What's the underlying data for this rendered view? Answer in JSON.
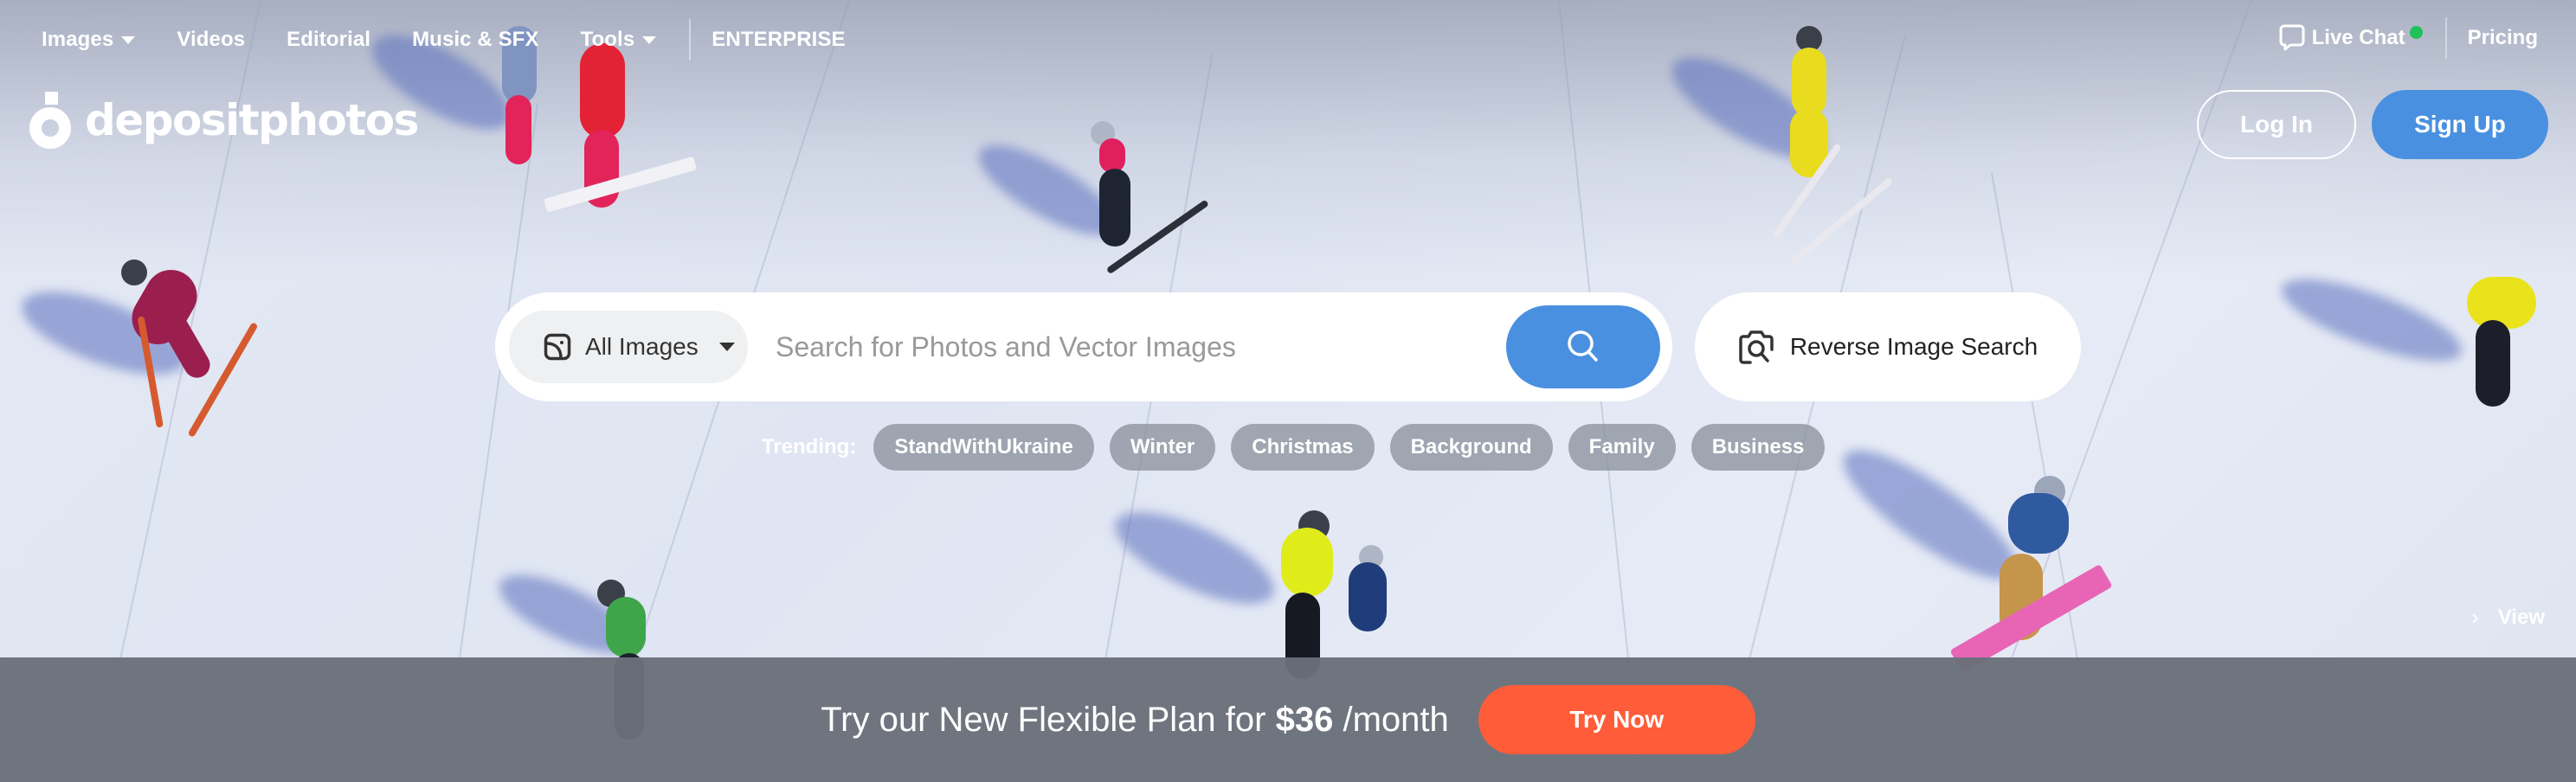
{
  "nav": {
    "items": [
      {
        "label": "Images",
        "has_dropdown": true
      },
      {
        "label": "Videos",
        "has_dropdown": false
      },
      {
        "label": "Editorial",
        "has_dropdown": false
      },
      {
        "label": "Music & SFX",
        "has_dropdown": false
      },
      {
        "label": "Tools",
        "has_dropdown": true
      }
    ],
    "enterprise": "ENTERPRISE",
    "live_chat": "Live Chat",
    "live_chat_status": "online",
    "pricing": "Pricing"
  },
  "logo": {
    "text": "depositphotos"
  },
  "auth": {
    "login": "Log In",
    "signup": "Sign Up"
  },
  "search": {
    "type_selected": "All Images",
    "placeholder": "Search for Photos and Vector Images",
    "value": "",
    "reverse_label": "Reverse Image Search"
  },
  "trending": {
    "label": "Trending:",
    "tags": [
      "StandWithUkraine",
      "Winter",
      "Christmas",
      "Background",
      "Family",
      "Business"
    ]
  },
  "view_link": "View",
  "promo": {
    "text_before": "Try our New Flexible Plan for ",
    "price": "$36",
    "text_after": " /month",
    "cta": "Try Now"
  },
  "colors": {
    "primary_blue": "#4a90e0",
    "cta_orange": "#ff5c39",
    "online_green": "#1ec15a",
    "promo_bar": "#6a6f7a",
    "tag_bg": "#8c929e"
  }
}
